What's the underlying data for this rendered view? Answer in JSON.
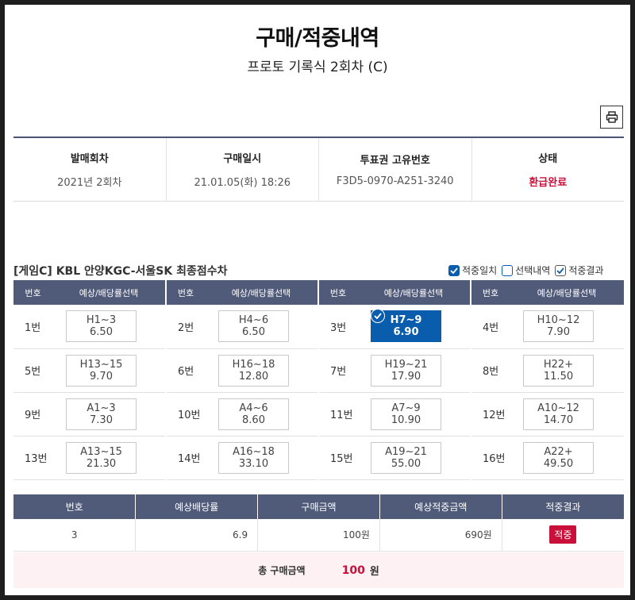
{
  "header": {
    "title": "구매/적중내역",
    "subtitle": "프로토 기록식 2회차 (C)"
  },
  "toolbar": {
    "print_icon": "printer-icon"
  },
  "info": [
    {
      "label": "발매회차",
      "value": "2021년 2회차"
    },
    {
      "label": "구매일시",
      "value": "21.01.05(화) 18:26"
    },
    {
      "label": "투표권 고유번호",
      "value": "F3D5-0970-A251-3240"
    },
    {
      "label": "상태",
      "value": "환급완료"
    }
  ],
  "game": {
    "title": "[게임C] KBL 안양KGC-서울SK 최종점수차",
    "legend": [
      "적중일치",
      "선택내역",
      "적중결과"
    ],
    "col_num": "번호",
    "col_select": "예상/배당률선택",
    "options": [
      {
        "num": "1번",
        "range": "H1~3",
        "odds": "6.50"
      },
      {
        "num": "2번",
        "range": "H4~6",
        "odds": "6.50"
      },
      {
        "num": "3번",
        "range": "H7~9",
        "odds": "6.90",
        "selected": true
      },
      {
        "num": "4번",
        "range": "H10~12",
        "odds": "7.90"
      },
      {
        "num": "5번",
        "range": "H13~15",
        "odds": "9.70"
      },
      {
        "num": "6번",
        "range": "H16~18",
        "odds": "12.80"
      },
      {
        "num": "7번",
        "range": "H19~21",
        "odds": "17.90"
      },
      {
        "num": "8번",
        "range": "H22+",
        "odds": "11.50"
      },
      {
        "num": "9번",
        "range": "A1~3",
        "odds": "7.30"
      },
      {
        "num": "10번",
        "range": "A4~6",
        "odds": "8.60"
      },
      {
        "num": "11번",
        "range": "A7~9",
        "odds": "10.90"
      },
      {
        "num": "12번",
        "range": "A10~12",
        "odds": "14.70"
      },
      {
        "num": "13번",
        "range": "A13~15",
        "odds": "21.30"
      },
      {
        "num": "14번",
        "range": "A16~18",
        "odds": "33.10"
      },
      {
        "num": "15번",
        "range": "A19~21",
        "odds": "55.00"
      },
      {
        "num": "16번",
        "range": "A22+",
        "odds": "49.50"
      }
    ]
  },
  "result": {
    "headers": [
      "번호",
      "예상배당률",
      "구매금액",
      "예상적중금액",
      "적중결과"
    ],
    "row": {
      "num": "3",
      "odds": "6.9",
      "amount": "100원",
      "expected": "690원",
      "outcome": "적중"
    }
  },
  "total": {
    "label": "총 구매금액",
    "amount": "100",
    "unit": "원"
  },
  "colors": {
    "header_bg": "#505a79",
    "accent_blue": "#0a5dad",
    "accent_red": "#c8103a"
  }
}
